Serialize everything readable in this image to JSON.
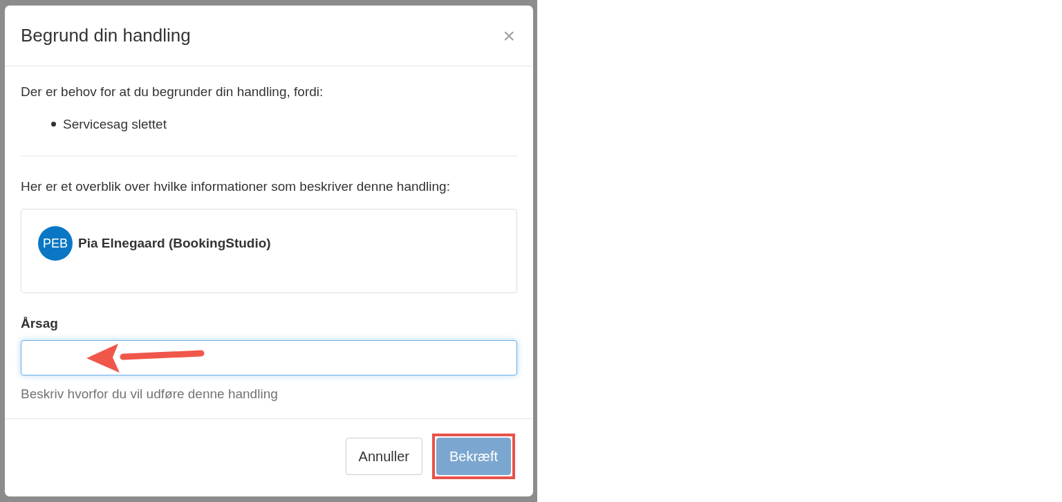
{
  "modal": {
    "title": "Begrund din handling",
    "close_label": "×",
    "intro": "Der er behov for at du begrunder din handling, fordi:",
    "reasons": [
      "Servicesag slettet"
    ],
    "overview_text": "Her er et overblik over hvilke informationer som beskriver denne handling:",
    "entities": [
      {
        "initials": "PEB",
        "name": "Pia Elnegaard (BookingStudio)"
      }
    ],
    "field": {
      "label": "Årsag",
      "help": "Beskriv hvorfor du vil udføre denne handling",
      "focused": true
    },
    "buttons": [
      {
        "label": "Annuller",
        "kind": "default",
        "disabled": false,
        "highlighted": false
      },
      {
        "label": "Bekræft",
        "kind": "primary",
        "disabled": true,
        "highlighted": true
      }
    ]
  }
}
